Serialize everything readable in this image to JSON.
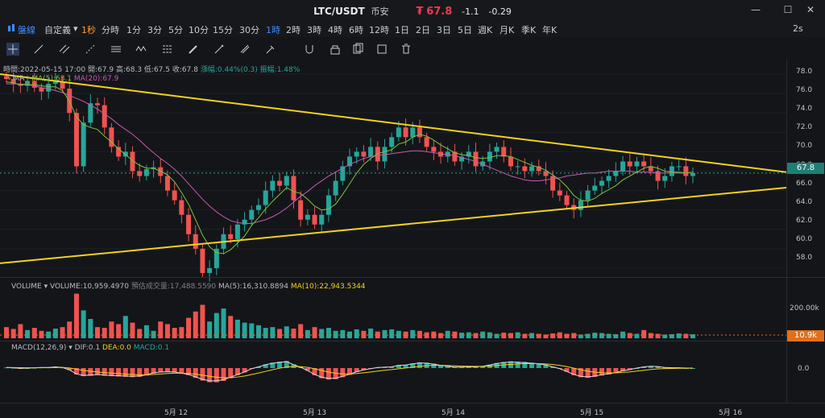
{
  "window": {
    "symbol": "LTC/USDT",
    "exchange": "币安",
    "currency_glyph": "₮",
    "price": "67.8",
    "change": "-1.1",
    "change_pct": "-0.29"
  },
  "timeframes": {
    "line": "盤線",
    "custom": "自定義",
    "items": [
      "1秒",
      "分時",
      "1分",
      "3分",
      "5分",
      "10分",
      "15分",
      "30分",
      "1時",
      "2時",
      "3時",
      "4時",
      "6時",
      "12時",
      "1日",
      "2日",
      "3日",
      "5日",
      "週K",
      "月K",
      "季K",
      "年K"
    ],
    "active": "1時",
    "playback": "2s"
  },
  "info_line": {
    "time": "時間:2022-05-15 17:00",
    "open": "開:67.9",
    "high": "高:68.3",
    "low": "低:67.5",
    "close": "收:67.8",
    "change": "漲幅:0.44%(0.3)",
    "amplitude": "振幅:1.48%"
  },
  "ma_legend": {
    "name": "MA",
    "ma5": "MA(5):68.1",
    "ma20": "MA(20):67.9"
  },
  "volume_legend": {
    "name": "VOLUME",
    "volume": "VOLUME:10,959.4970",
    "forecast": "預估成交量:17,488.5590",
    "ma5": "MA(5):16,310.8894",
    "ma10": "MA(10):22,943.5344"
  },
  "macd_legend": {
    "name": "MACD(12,26,9)",
    "dif": "DIF:0.1",
    "dea": "DEA:0.0",
    "macd": "MACD:0.1"
  },
  "price_axis": [
    "78.0",
    "76.0",
    "74.0",
    "72.0",
    "70.0",
    "68.0",
    "66.0",
    "64.0",
    "62.0",
    "60.0",
    "58.0"
  ],
  "price_tag": "67.8",
  "volume_axis": "200.00k",
  "volume_tag": "10.9k",
  "macd_axis": "0.0",
  "date_axis": [
    "5月 12",
    "5月 13",
    "5月 14",
    "5月 15",
    "5月 16"
  ],
  "colors": {
    "up": "#26a69a",
    "down": "#ef5350",
    "ma5": "#7cc33d",
    "ma20": "#c75ab0",
    "trend": "#f2d21b",
    "accent": "#3b8cff",
    "price_red": "#f0394d"
  },
  "chart_data": {
    "type": "candlestick",
    "interval": "1時",
    "ylim": [
      57,
      79
    ],
    "closes": [
      77.5,
      77.0,
      76.8,
      77.3,
      76.6,
      76.2,
      77.0,
      77.2,
      76.5,
      74.0,
      68.5,
      73.0,
      75.0,
      74.8,
      72.5,
      70.5,
      69.5,
      70.0,
      68.0,
      67.5,
      68.2,
      68.4,
      67.5,
      66.0,
      65.0,
      63.5,
      61.5,
      60.0,
      57.5,
      58.0,
      60.0,
      61.5,
      61.0,
      62.5,
      63.0,
      64.0,
      64.5,
      66.0,
      67.0,
      66.5,
      67.5,
      65.0,
      63.0,
      63.5,
      62.5,
      63.5,
      65.5,
      67.0,
      68.5,
      69.5,
      70.0,
      69.5,
      70.5,
      69.0,
      70.5,
      71.5,
      72.5,
      71.5,
      72.5,
      71.5,
      70.5,
      70.0,
      69.5,
      70.0,
      69.0,
      69.5,
      70.0,
      68.5,
      69.0,
      70.0,
      70.5,
      69.5,
      68.5,
      68.5,
      68.0,
      68.5,
      68.0,
      67.5,
      66.0,
      65.5,
      64.5,
      64.0,
      65.0,
      66.0,
      66.5,
      67.0,
      67.5,
      68.0,
      69.0,
      68.5,
      69.0,
      68.5,
      68.0,
      67.0,
      67.5,
      68.5,
      68.5,
      67.5,
      67.8
    ],
    "ma5": [
      77.2,
      77.1,
      76.9,
      76.9,
      76.9,
      76.8,
      76.7,
      76.7,
      76.3,
      75.2,
      73.6,
      72.8,
      72.5,
      72.3,
      71.6,
      71.0,
      70.3,
      69.7,
      69.1,
      68.6,
      68.3,
      68.3,
      68.0,
      67.6,
      66.9,
      65.8,
      64.6,
      63.0,
      61.4,
      60.2,
      59.6,
      59.5,
      59.9,
      60.6,
      61.3,
      62.4,
      63.2,
      64.1,
      64.9,
      65.6,
      66.3,
      65.9,
      65.7,
      65.1,
      64.4,
      64.0,
      64.1,
      64.6,
      65.6,
      66.7,
      67.8,
      68.7,
      69.3,
      69.8,
      70.0,
      70.2,
      70.8,
      71.0,
      71.5,
      71.8,
      71.6,
      71.2,
      70.7,
      70.3,
      69.9,
      69.7,
      69.6,
      69.4,
      69.3,
      69.4,
      69.6,
      69.6,
      69.5,
      69.2,
      68.9,
      68.6,
      68.4,
      68.1,
      67.6,
      67.1,
      66.4,
      65.5,
      65.0,
      64.9,
      65.2,
      65.7,
      66.1,
      66.5,
      67.1,
      67.5,
      67.9,
      68.3,
      68.5,
      68.3,
      68.0,
      67.9,
      67.9,
      67.8,
      67.9
    ],
    "ma20": [
      77.0,
      77.0,
      77.0,
      76.9,
      76.8,
      76.6,
      76.5,
      76.3,
      76.1,
      75.8,
      75.5,
      75.2,
      74.8,
      74.4,
      73.9,
      73.4,
      72.8,
      72.3,
      71.8,
      71.2,
      70.5,
      69.9,
      69.3,
      68.8,
      68.2,
      67.5,
      66.7,
      65.9,
      65.1,
      64.4,
      63.8,
      63.3,
      62.9,
      62.7,
      62.6,
      62.6,
      62.8,
      63.0,
      63.3,
      63.7,
      64.2,
      64.8,
      65.4,
      65.9,
      66.5,
      67.0,
      67.5,
      67.9,
      68.3,
      68.7,
      69.0,
      69.3,
      69.5,
      69.6,
      69.7,
      69.8,
      69.9,
      70.0,
      70.1,
      70.1,
      70.0,
      69.9,
      69.8,
      69.7,
      69.6,
      69.4,
      69.2,
      69.0,
      68.7,
      68.4,
      68.1,
      67.8,
      67.5,
      67.3,
      67.1,
      67.0,
      67.0,
      67.1,
      67.2,
      67.3,
      67.5,
      67.6,
      67.7,
      67.8,
      67.8,
      67.9,
      68.0,
      68.0,
      68.0,
      68.0,
      67.9,
      67.9,
      67.9,
      67.8,
      67.8,
      67.8,
      67.8,
      67.8,
      67.9
    ],
    "last_price": 67.8,
    "volume": {
      "values": [
        30,
        25,
        38,
        22,
        28,
        20,
        18,
        26,
        30,
        45,
        120,
        75,
        52,
        30,
        28,
        45,
        38,
        60,
        42,
        25,
        35,
        20,
        45,
        38,
        28,
        30,
        55,
        72,
        90,
        45,
        68,
        80,
        60,
        50,
        42,
        40,
        35,
        28,
        30,
        25,
        32,
        26,
        38,
        22,
        30,
        25,
        28,
        20,
        22,
        18,
        24,
        20,
        26,
        18,
        22,
        24,
        20,
        18,
        22,
        20,
        16,
        18,
        14,
        20,
        18,
        15,
        16,
        14,
        18,
        16,
        12,
        15,
        14,
        16,
        12,
        14,
        12,
        10,
        13,
        16,
        12,
        14,
        10,
        12,
        15,
        14,
        12,
        11,
        18,
        14,
        12,
        22,
        14,
        12,
        10,
        11,
        13,
        12,
        10.9
      ],
      "axis_label": "200.00k",
      "last": "10.9k"
    },
    "macd": {
      "dif": 0.1,
      "dea": 0.0,
      "macd": 0.1
    },
    "x_ticks": [
      "5月 12",
      "5月 13",
      "5月 14",
      "5月 15",
      "5月 16"
    ]
  }
}
